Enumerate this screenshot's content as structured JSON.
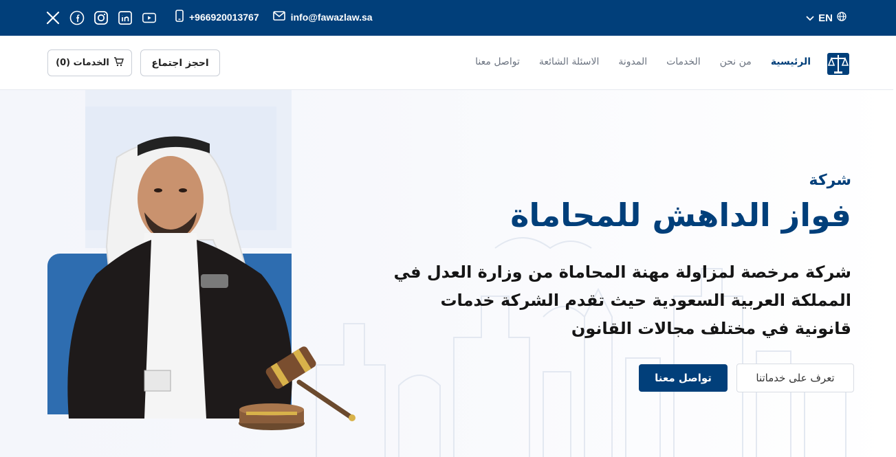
{
  "topbar": {
    "social_icons": [
      "x-icon",
      "facebook-icon",
      "instagram-icon",
      "linkedin-icon",
      "youtube-icon"
    ],
    "phone": "+966920013767",
    "email": "info@fawazlaw.sa",
    "language": "EN"
  },
  "nav": {
    "menu": [
      {
        "label": "الرئيسية",
        "active": true
      },
      {
        "label": "من نحن",
        "active": false
      },
      {
        "label": "الخدمات",
        "active": false
      },
      {
        "label": "المدونة",
        "active": false
      },
      {
        "label": "الاسئلة الشائعة",
        "active": false
      },
      {
        "label": "تواصل معنا",
        "active": false
      }
    ],
    "meeting_button": "احجز اجتماع",
    "cart_button": "(0) الخدمات"
  },
  "hero": {
    "kicker": "شركة",
    "title": "فواز الداهش للمحاماة",
    "description": "شركة مرخصة لمزاولة مهنة المحاماة من وزارة العدل في المملكة العربية السعودية حيث تقدم الشركة خدمات قانونية في مختلف مجالات القانون",
    "primary_button": "تواصل معنا",
    "secondary_button": "تعرف على خدماتنا"
  },
  "colors": {
    "brand": "#013f7a",
    "accent": "#2e6db0"
  }
}
